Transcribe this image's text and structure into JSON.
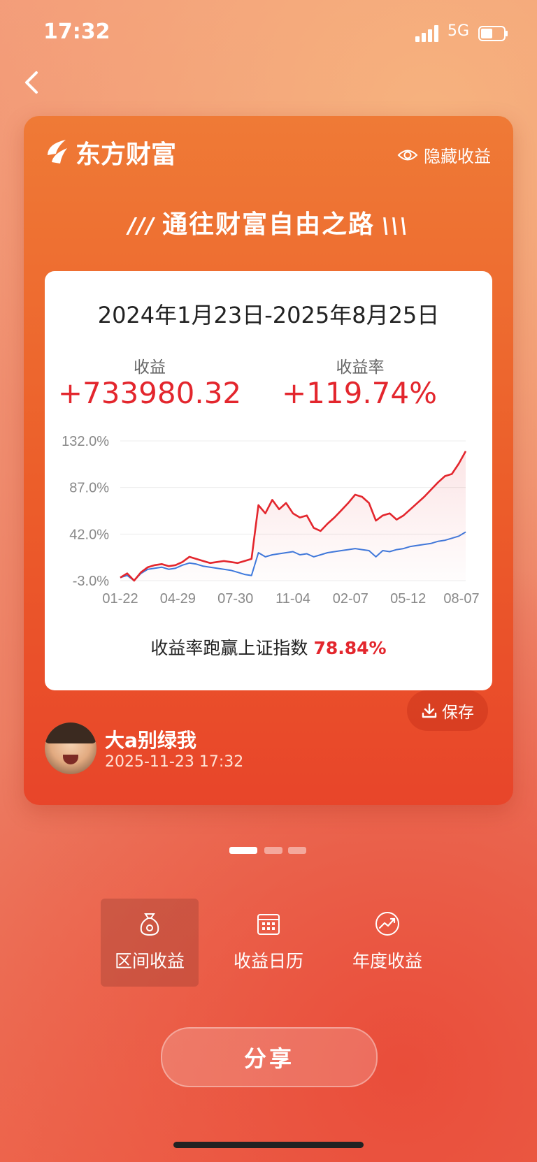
{
  "status": {
    "time": "17:32",
    "network": "5G"
  },
  "card": {
    "brand": "东方财富",
    "hide_label": "隐藏收益",
    "slogan": "通往财富自由之路",
    "date_range": "2024年1月23日-2025年8月25日",
    "profit_label": "收益",
    "profit_value": "+733980.32",
    "rate_label": "收益率",
    "rate_value": "+119.74%",
    "outperform_text": "收益率跑赢上证指数",
    "outperform_value": "78.84%",
    "user_name": "大a别绿我",
    "user_time": "2025-11-23 17:32",
    "save_label": "保存"
  },
  "tabs": [
    {
      "label": "区间收益",
      "icon": "money-bag-icon",
      "active": true
    },
    {
      "label": "收益日历",
      "icon": "calendar-icon",
      "active": false
    },
    {
      "label": "年度收益",
      "icon": "trend-circle-icon",
      "active": false
    }
  ],
  "share_label": "分享",
  "colors": {
    "accent_red": "#e3262d",
    "index_blue": "#3b7be0",
    "card_orange": "#ec5d2a"
  },
  "chart_data": {
    "type": "line",
    "x_tick_labels": [
      "01-22",
      "04-29",
      "07-30",
      "11-04",
      "02-07",
      "05-12",
      "08-07"
    ],
    "y_tick_labels": [
      "132.0%",
      "87.0%",
      "42.0%",
      "-3.0%"
    ],
    "ylim": [
      -3,
      132
    ],
    "grid": true,
    "series": [
      {
        "color": "#e3262d",
        "fill": true,
        "x": [
          0,
          2,
          4,
          6,
          8,
          10,
          12,
          14,
          16,
          18,
          20,
          22,
          24,
          26,
          28,
          30,
          32,
          34,
          36,
          38,
          40,
          42,
          44,
          46,
          48,
          50,
          52,
          54,
          56,
          58,
          60,
          62,
          64,
          66,
          68,
          70,
          72,
          74,
          76,
          78,
          80,
          82,
          84,
          86,
          88,
          90,
          92,
          94,
          96,
          98,
          100
        ],
        "values": [
          0,
          4,
          -3,
          5,
          10,
          12,
          13,
          11,
          12,
          15,
          20,
          18,
          16,
          14,
          15,
          16,
          15,
          14,
          16,
          18,
          70,
          62,
          75,
          66,
          72,
          62,
          58,
          60,
          48,
          45,
          52,
          58,
          65,
          72,
          80,
          78,
          72,
          55,
          60,
          62,
          56,
          60,
          66,
          72,
          78,
          85,
          92,
          98,
          100,
          110,
          122
        ]
      },
      {
        "color": "#3b7be0",
        "fill": false,
        "x": [
          0,
          2,
          4,
          6,
          8,
          10,
          12,
          14,
          16,
          18,
          20,
          22,
          24,
          26,
          28,
          30,
          32,
          34,
          36,
          38,
          40,
          42,
          44,
          46,
          48,
          50,
          52,
          54,
          56,
          58,
          60,
          62,
          64,
          66,
          68,
          70,
          72,
          74,
          76,
          78,
          80,
          82,
          84,
          86,
          88,
          90,
          92,
          94,
          96,
          98,
          100
        ],
        "values": [
          0,
          2,
          -3,
          4,
          8,
          9,
          10,
          8,
          9,
          12,
          14,
          13,
          11,
          10,
          9,
          8,
          7,
          5,
          3,
          2,
          24,
          20,
          22,
          23,
          24,
          25,
          22,
          23,
          20,
          22,
          24,
          25,
          26,
          27,
          28,
          27,
          26,
          20,
          26,
          25,
          27,
          28,
          30,
          31,
          32,
          33,
          35,
          36,
          38,
          40,
          44
        ]
      }
    ]
  }
}
